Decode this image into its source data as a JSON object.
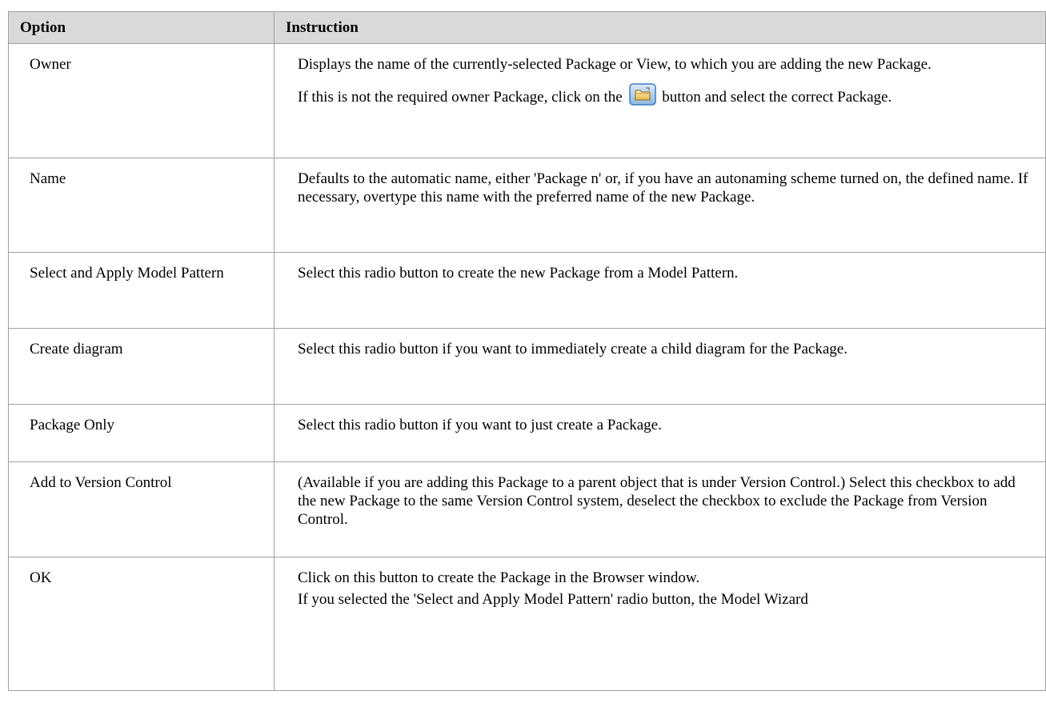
{
  "table": {
    "headers": {
      "option": "Option",
      "instruction": "Instruction"
    },
    "rows": [
      {
        "option": "Owner",
        "paragraphs": [
          "Displays the name of the currently-selected Package or View, to which you are adding the new Package."
        ],
        "icon_paragraph": {
          "before": "If this is not the required owner Package, click on the",
          "icon": "folder-browse-icon",
          "after": "button and select the correct Package."
        }
      },
      {
        "option": "Name",
        "paragraphs": [
          "Defaults to the automatic name, either 'Package n' or, if you have an autonaming scheme turned on, the defined name. If necessary, overtype this name with the preferred name of the new Package."
        ]
      },
      {
        "option": "Select and Apply Model Pattern",
        "paragraphs": [
          "Select this radio button to create the new Package from a Model Pattern."
        ]
      },
      {
        "option": "Create diagram",
        "paragraphs": [
          "Select this radio button if you want to immediately create a child diagram for the Package."
        ]
      },
      {
        "option": "Package Only",
        "paragraphs": [
          "Select this radio button if you want to just create a Package."
        ]
      },
      {
        "option": "Add to Version Control",
        "paragraphs": [
          "(Available if you are adding this Package to a parent object that is under Version Control.) Select this checkbox to add the new Package to the same Version Control system, deselect the checkbox to exclude the Package from Version Control."
        ]
      },
      {
        "option": "OK",
        "paragraphs": [
          "Click on this button to create the Package in the Browser window.",
          "If you selected the 'Select and Apply Model Pattern' radio button, the Model Wizard"
        ]
      }
    ]
  },
  "colors": {
    "header_background": "#d9d9d9",
    "border": "#a0a0a0",
    "icon_frame": "#3a7bbf",
    "icon_folder": "#e8b84a"
  }
}
